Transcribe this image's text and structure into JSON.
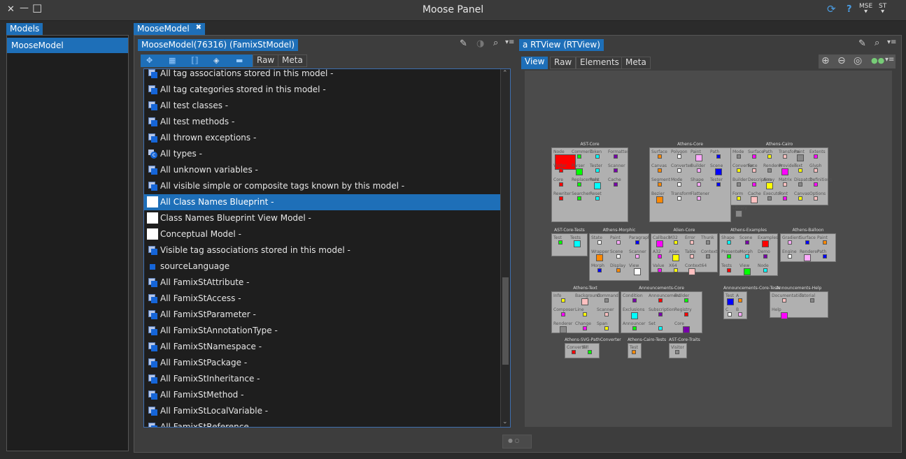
{
  "window": {
    "title": "Moose Panel",
    "close_glyph": "✕",
    "min_glyph": "—",
    "max_glyph": "□",
    "right_buttons": [
      "⟳",
      "?",
      "MSE",
      "ST"
    ]
  },
  "models_tab": "Models",
  "models": [
    "MooseModel"
  ],
  "editor_tab": {
    "label": "MooseModel",
    "close": "✖"
  },
  "browser": {
    "title": "MooseModel(76316) (FamixStModel)",
    "subtabs": [
      "Raw",
      "Meta"
    ],
    "rows": [
      {
        "label": "All tag associations stored in this model -",
        "icon": "dbl"
      },
      {
        "label": "All tag categories stored in this model -",
        "icon": "dbl"
      },
      {
        "label": "All test classes -",
        "icon": "dbl"
      },
      {
        "label": "All test methods -",
        "icon": "dbl"
      },
      {
        "label": "All thrown exceptions -",
        "icon": "dbl"
      },
      {
        "label": "All types -",
        "icon": "gear"
      },
      {
        "label": "All unknown variables -",
        "icon": "dbl"
      },
      {
        "label": "All visible simple or composite tags known by this model -",
        "icon": "dbl"
      },
      {
        "label": "All Class Names Blueprint -",
        "icon": "white",
        "selected": true
      },
      {
        "label": "Class Names Blueprint View Model -",
        "icon": "white"
      },
      {
        "label": "Conceptual Model -",
        "icon": "white"
      },
      {
        "label": "Visible tag associations stored in this model -",
        "icon": "dbl"
      },
      {
        "label": "sourceLanguage",
        "icon": "sq"
      },
      {
        "label": "All FamixStAttribute -",
        "icon": "dbl"
      },
      {
        "label": "All FamixStAccess -",
        "icon": "dbl"
      },
      {
        "label": "All FamixStParameter -",
        "icon": "dbl"
      },
      {
        "label": "All FamixStAnnotationType -",
        "icon": "dbl"
      },
      {
        "label": "All FamixStNamespace -",
        "icon": "dbl"
      },
      {
        "label": "All FamixStPackage -",
        "icon": "dbl"
      },
      {
        "label": "All FamixStInheritance -",
        "icon": "dbl"
      },
      {
        "label": "All FamixStMethod -",
        "icon": "dbl"
      },
      {
        "label": "All FamixStLocalVariable -",
        "icon": "dbl"
      },
      {
        "label": "All FamixStReference -",
        "icon": "dbl"
      }
    ]
  },
  "rtview": {
    "title": "a RTView (RTView)",
    "subtabs": [
      "View",
      "Raw",
      "Elements",
      "Meta"
    ],
    "packages": [
      {
        "name": "AST-Core",
        "classes": [
          "Node",
          "Comment",
          "Token",
          "Formatter",
          "Visitor",
          "Parser",
          "Tester",
          "Scanner",
          "Core",
          "Replacement",
          "Rule",
          "Cache",
          "Rewriter",
          "Searcher",
          "Reset"
        ]
      },
      {
        "name": "Athens-Core",
        "classes": [
          "Surface",
          "Polygon",
          "Paint",
          "Path",
          "Canvas",
          "Converter",
          "Builder",
          "Scene",
          "Segment",
          "Mode",
          "Shape",
          "Tester",
          "Bezier",
          "Transform",
          "Flattener"
        ]
      },
      {
        "name": "Athens-Cairo",
        "classes": [
          "Mode",
          "Surface",
          "Path",
          "Transform",
          "Paint",
          "Extents",
          "Converter",
          "Face",
          "Renderer",
          "Provider",
          "Text",
          "Glyph",
          "Builder",
          "Description",
          "Array",
          "Matrix",
          "Dispatch",
          "Definitions",
          "Form",
          "Cache",
          "Executor",
          "Font",
          "Canvas",
          "Options",
          "Library"
        ]
      },
      {
        "name": "AST-Core-Tests",
        "classes": [
          "Test",
          "Tests"
        ]
      },
      {
        "name": "Athens-Morphic",
        "classes": [
          "State",
          "Paint",
          "Paragraph",
          "Wrapper",
          "Scene",
          "Scanner",
          "Morph",
          "Display",
          "View"
        ]
      },
      {
        "name": "Alien-Core",
        "classes": [
          "Callback",
          "M32",
          "Error",
          "Thunk",
          "A32",
          "Alien",
          "Table",
          "Context32",
          "Value",
          "X64",
          "Context64"
        ]
      },
      {
        "name": "Athens-Examples",
        "classes": [
          "Shape",
          "Scene",
          "Examples",
          "Presenter",
          "Morph",
          "Demo",
          "Tests",
          "View",
          "Node"
        ]
      },
      {
        "name": "Athens-Balloon",
        "classes": [
          "Gradient",
          "Surface",
          "Paint",
          "Engine",
          "Renderer",
          "Path"
        ]
      },
      {
        "name": "Athens-Text",
        "classes": [
          "Info",
          "Background",
          "Command",
          "Composer",
          "Line",
          "Scanner",
          "Renderer",
          "Change",
          "Span"
        ]
      },
      {
        "name": "Announcements-Core",
        "classes": [
          "Condition",
          "Announcement",
          "Builder",
          "Exclusions",
          "Subscription",
          "Registry",
          "Announcer",
          "Set",
          "Core"
        ]
      },
      {
        "name": "Announcements-Core-Tests",
        "classes": [
          "Test",
          "A",
          "C",
          "B"
        ]
      },
      {
        "name": "Announcements-Help",
        "classes": [
          "Documentation",
          "Tutorial",
          "Help"
        ]
      },
      {
        "name": "Athens-SVG-PathConverter",
        "classes": [
          "Converter",
          "Fill"
        ]
      },
      {
        "name": "Athens-Cairo-Tests",
        "classes": [
          "Test"
        ]
      },
      {
        "name": "AST-Core-Traits",
        "classes": [
          "Visitor"
        ]
      }
    ]
  }
}
